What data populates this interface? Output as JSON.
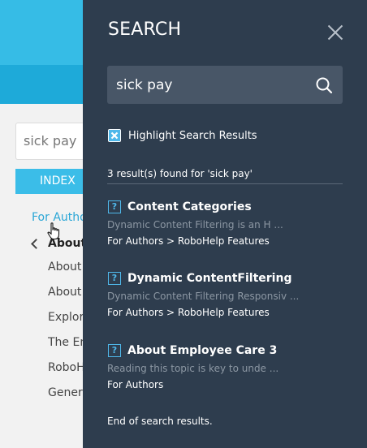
{
  "background": {
    "search_value": "sick pay",
    "index_button": "INDEX",
    "breadcrumb_link": "For Authors",
    "back_item": "About",
    "nav_items": [
      "About",
      "About",
      "Explor",
      "The En",
      "RoboH",
      "Genera"
    ]
  },
  "panel": {
    "title": "SEARCH",
    "search_value": "sick pay",
    "highlight_label": "Highlight Search Results",
    "highlight_checked": true,
    "results_summary": "3 result(s) found for 'sick pay'",
    "results": [
      {
        "title": "Content Categories",
        "snippet": "Dynamic Content Filtering is an H ...",
        "path": "For Authors > RoboHelp Features"
      },
      {
        "title": "Dynamic ContentFiltering",
        "snippet": "Dynamic Content Filtering Responsiv ...",
        "path": "For Authors > RoboHelp Features"
      },
      {
        "title": "About Employee Care 3",
        "snippet": "Reading this topic is key to unde ...",
        "path": "For Authors"
      }
    ],
    "end_text": "End of search results."
  },
  "colors": {
    "panel_bg": "#2e3d4e",
    "search_box_bg": "#485667",
    "accent_blue": "#36bce6",
    "header_blue": "#1eaad9",
    "link_blue": "#2aa6d6",
    "icon_blue": "#4fb8ea",
    "snippet_gray": "#8c97a3"
  },
  "icons": {
    "close": "close-icon",
    "search": "search-icon",
    "checkbox": "check-x-icon",
    "result": "help-topic-icon",
    "back": "chevron-left-icon",
    "cursor": "hand-pointer-cursor-icon"
  }
}
